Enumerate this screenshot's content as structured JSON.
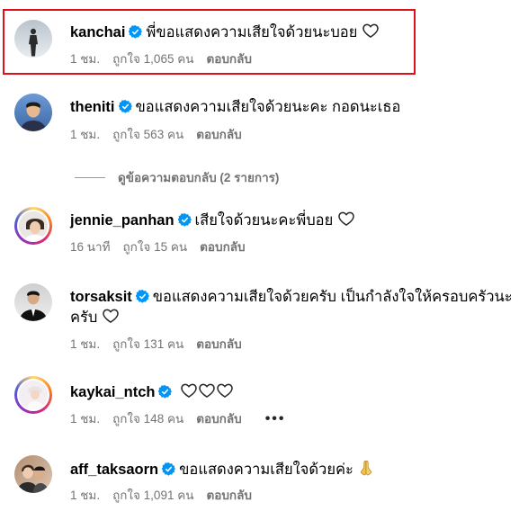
{
  "accent_verified": "#0095f6",
  "highlight_color": "#e0101a",
  "comments": [
    {
      "username": "kanchai",
      "text": "พี่ขอแสดงความเสียใจด้วยนะบอย",
      "time": "1 ชม.",
      "likes": "ถูกใจ 1,065 คน",
      "reply": "ตอบกลับ",
      "trailing_icon": "heart-outline-icon"
    },
    {
      "username": "theniti",
      "text": "ขอแสดงความเสียใจด้วยนะคะ กอดนะเธอ",
      "time": "1 ชม.",
      "likes": "ถูกใจ 563 คน",
      "reply": "ตอบกลับ"
    },
    {
      "username": "jennie_panhan",
      "text": "เสียใจด้วยนะคะพี่บอย",
      "time": "16 นาที",
      "likes": "ถูกใจ 15 คน",
      "reply": "ตอบกลับ",
      "trailing_icon": "heart-outline-icon"
    },
    {
      "username": "torsaksit",
      "text": "ขอแสดงความเสียใจด้วยครับ เป็นกำลังใจให้ครอบครัวนะครับ",
      "time": "1 ชม.",
      "likes": "ถูกใจ 131 คน",
      "reply": "ตอบกลับ",
      "trailing_icon": "heart-outline-icon"
    },
    {
      "username": "kaykai_ntch",
      "text": "",
      "time": "1 ชม.",
      "likes": "ถูกใจ 148 คน",
      "reply": "ตอบกลับ",
      "more": "•••",
      "trailing_icon": "three-heart-outline-icons"
    },
    {
      "username": "aff_taksaorn",
      "text": "ขอแสดงความเสียใจด้วยค่ะ",
      "time": "1 ชม.",
      "likes": "ถูกใจ 1,091 คน",
      "reply": "ตอบกลับ",
      "trailing_icon": "folded-hands-emoji"
    }
  ],
  "view_replies": "ดูข้อความตอบกลับ (2 รายการ)"
}
